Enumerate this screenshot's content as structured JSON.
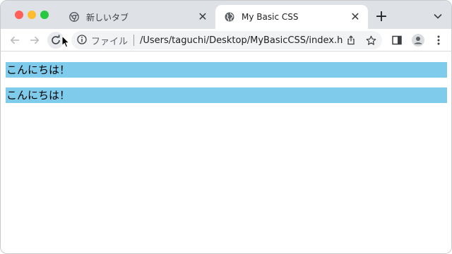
{
  "browser": {
    "tabs": [
      {
        "title": "新しいタブ",
        "active": false,
        "favicon": "chrome-icon"
      },
      {
        "title": "My Basic CSS",
        "active": true,
        "favicon": "globe-icon"
      }
    ],
    "address_bar": {
      "site_info_label": "ファイル",
      "url": "/Users/taguchi/Desktop/MyBasicCSS/index.html"
    }
  },
  "page": {
    "paragraphs": [
      {
        "text": "こんにちは！",
        "background": "#7ecbec"
      },
      {
        "text": "こんにちは！",
        "background": "#7ecbec"
      }
    ]
  }
}
